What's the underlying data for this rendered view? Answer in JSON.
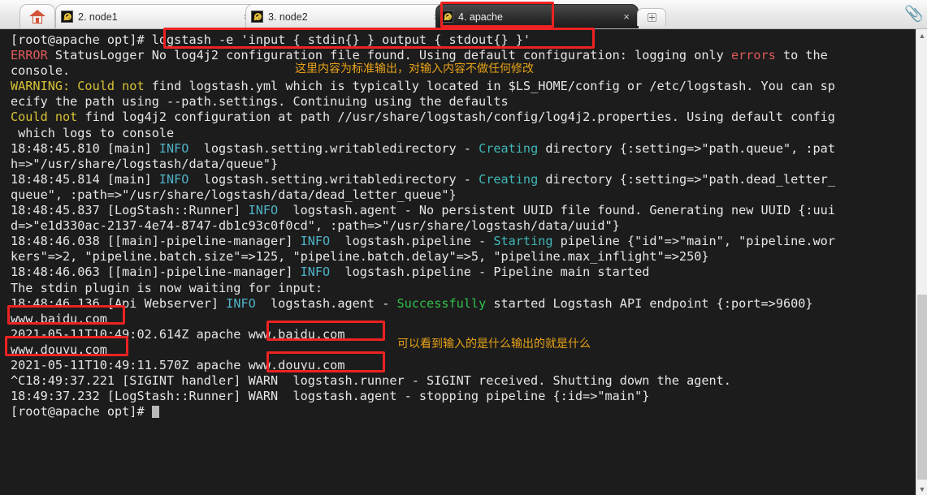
{
  "window": {
    "tabs": [
      {
        "label": "2. node1",
        "active": false,
        "icon": "wrench-icon"
      },
      {
        "label": "3. node2",
        "active": false,
        "icon": "wrench-icon"
      },
      {
        "label": "4. apache",
        "active": true,
        "icon": "wrench-icon"
      }
    ],
    "home_tab_icon": "home-icon",
    "new_tab_label": "+",
    "close_label": "×",
    "attachment_icon": "paperclip-icon"
  },
  "colors": {
    "terminal_bg": "#1c1c1c",
    "terminal_fg": "#e6e6e6",
    "error_red": "#e05a5a",
    "warn_yellow": "#d7c234",
    "info_cyan": "#4fb3c8",
    "ok_green": "#2fc14b",
    "annotation_orange": "#e8a317",
    "highlight_box": "#ee2222"
  },
  "terminal": {
    "prompt": "[root@apache opt]# ",
    "command": "logstash -e 'input { stdin{} } output { stdout{} }'",
    "final_prompt": "[root@apache opt]# ",
    "lines": [
      {
        "id": "l1",
        "segments": [
          {
            "t": "[root@apache opt]# ",
            "c": "c-white"
          },
          {
            "t": "logstash -e 'input { stdin{} } output { stdout{} }'",
            "c": "c-white"
          }
        ]
      },
      {
        "id": "l2",
        "segments": [
          {
            "t": "ERROR",
            "c": "c-red"
          },
          {
            "t": " StatusLogger No log4j2 configuration file found. Using default configuration: logging only ",
            "c": "c-white"
          },
          {
            "t": "errors",
            "c": "c-red"
          },
          {
            "t": " to the",
            "c": "c-white"
          }
        ]
      },
      {
        "id": "l3",
        "segments": [
          {
            "t": "console.",
            "c": "c-white"
          }
        ]
      },
      {
        "id": "l4",
        "segments": [
          {
            "t": "WARNING: Could not",
            "c": "c-yellow"
          },
          {
            "t": " find logstash.yml which is typically located in $LS_HOME/config or /etc/logstash. You can sp",
            "c": "c-white"
          }
        ]
      },
      {
        "id": "l5",
        "segments": [
          {
            "t": "ecify the path using --path.settings. Continuing using the defaults",
            "c": "c-white"
          }
        ]
      },
      {
        "id": "l6",
        "segments": [
          {
            "t": "Could not",
            "c": "c-yellow"
          },
          {
            "t": " find log4j2 configuration at path //usr/share/logstash/config/log4j2.properties. Using default config",
            "c": "c-white"
          }
        ]
      },
      {
        "id": "l7",
        "segments": [
          {
            "t": " which logs to console",
            "c": "c-white"
          }
        ]
      },
      {
        "id": "l8",
        "segments": [
          {
            "t": "18:48:45.810 [main] ",
            "c": "c-white"
          },
          {
            "t": "INFO",
            "c": "c-cyan"
          },
          {
            "t": "  logstash.setting.writabledirectory - ",
            "c": "c-white"
          },
          {
            "t": "Creating",
            "c": "c-teal"
          },
          {
            "t": " directory {:setting=>\"path.queue\", :pat",
            "c": "c-white"
          }
        ]
      },
      {
        "id": "l9",
        "segments": [
          {
            "t": "h=>\"/usr/share/logstash/data/queue\"}",
            "c": "c-white"
          }
        ]
      },
      {
        "id": "l10",
        "segments": [
          {
            "t": "18:48:45.814 [main] ",
            "c": "c-white"
          },
          {
            "t": "INFO",
            "c": "c-cyan"
          },
          {
            "t": "  logstash.setting.writabledirectory - ",
            "c": "c-white"
          },
          {
            "t": "Creating",
            "c": "c-teal"
          },
          {
            "t": " directory {:setting=>\"path.dead_letter_",
            "c": "c-white"
          }
        ]
      },
      {
        "id": "l11",
        "segments": [
          {
            "t": "queue\", :path=>\"/usr/share/logstash/data/dead_letter_queue\"}",
            "c": "c-white"
          }
        ]
      },
      {
        "id": "l12",
        "segments": [
          {
            "t": "18:48:45.837 [LogStash::Runner] ",
            "c": "c-white"
          },
          {
            "t": "INFO",
            "c": "c-cyan"
          },
          {
            "t": "  logstash.agent - No persistent UUID file found. Generating new UUID {:uui",
            "c": "c-white"
          }
        ]
      },
      {
        "id": "l13",
        "segments": [
          {
            "t": "d=>\"e1d330ac-2137-4e74-8747-db1c93c0f0cd\", :path=>\"/usr/share/logstash/data/uuid\"}",
            "c": "c-white"
          }
        ]
      },
      {
        "id": "l14",
        "segments": [
          {
            "t": "18:48:46.038 [[main]-pipeline-manager] ",
            "c": "c-white"
          },
          {
            "t": "INFO",
            "c": "c-cyan"
          },
          {
            "t": "  logstash.pipeline - ",
            "c": "c-white"
          },
          {
            "t": "Starting",
            "c": "c-teal"
          },
          {
            "t": " pipeline {\"id\"=>\"main\", \"pipeline.wor",
            "c": "c-white"
          }
        ]
      },
      {
        "id": "l15",
        "segments": [
          {
            "t": "kers\"=>2, \"pipeline.batch.size\"=>125, \"pipeline.batch.delay\"=>5, \"pipeline.max_inflight\"=>250}",
            "c": "c-white"
          }
        ]
      },
      {
        "id": "l16",
        "segments": [
          {
            "t": "18:48:46.063 [[main]-pipeline-manager] ",
            "c": "c-white"
          },
          {
            "t": "INFO",
            "c": "c-cyan"
          },
          {
            "t": "  logstash.pipeline - Pipeline main started",
            "c": "c-white"
          }
        ]
      },
      {
        "id": "l17",
        "segments": [
          {
            "t": "The stdin plugin is now waiting for input:",
            "c": "c-white"
          }
        ]
      },
      {
        "id": "l18",
        "segments": [
          {
            "t": "18:48:46.136 [Api Webserver] ",
            "c": "c-white"
          },
          {
            "t": "INFO",
            "c": "c-cyan"
          },
          {
            "t": "  logstash.agent - ",
            "c": "c-white"
          },
          {
            "t": "Successfully",
            "c": "c-green"
          },
          {
            "t": " started Logstash API endpoint {:port=>9600}",
            "c": "c-white"
          }
        ]
      },
      {
        "id": "l19",
        "segments": [
          {
            "t": "www.baidu.com",
            "c": "c-white"
          }
        ]
      },
      {
        "id": "l20",
        "segments": [
          {
            "t": "2021-05-11T10:49:02.614Z apache www.baidu.com",
            "c": "c-white"
          }
        ]
      },
      {
        "id": "l21",
        "segments": [
          {
            "t": "www.douyu.com",
            "c": "c-white"
          }
        ]
      },
      {
        "id": "l22",
        "segments": [
          {
            "t": "2021-05-11T10:49:11.570Z apache www.douyu.com",
            "c": "c-white"
          }
        ]
      },
      {
        "id": "l23",
        "segments": [
          {
            "t": "^C18:49:37.221 [SIGINT handler] WARN  logstash.runner - SIGINT received. Shutting down the agent.",
            "c": "c-white"
          }
        ]
      },
      {
        "id": "l24",
        "segments": [
          {
            "t": "18:49:37.232 [LogStash::Runner] WARN  logstash.agent - stopping pipeline {:id=>\"main\"}",
            "c": "c-white"
          }
        ]
      },
      {
        "id": "l25",
        "segments": [
          {
            "t": "[root@apache opt]# ",
            "c": "c-white"
          },
          {
            "t": "█",
            "c": "c-cursor"
          }
        ]
      }
    ]
  },
  "annotations": [
    {
      "id": "a1",
      "text": "这里内容为标准输出，对输入内容不做任何修改"
    },
    {
      "id": "a2",
      "text": "可以看到输入的是什么输出的就是什么"
    }
  ],
  "highlight_boxes": [
    {
      "id": "hb-command",
      "target": "logstash-command"
    },
    {
      "id": "hb-tab-apache",
      "target": "tab-4-apache"
    },
    {
      "id": "hb-input-baidu",
      "target": "stdin-baidu"
    },
    {
      "id": "hb-out-baidu",
      "target": "stdout-baidu"
    },
    {
      "id": "hb-input-douyu",
      "target": "stdin-douyu"
    },
    {
      "id": "hb-out-douyu",
      "target": "stdout-douyu"
    }
  ],
  "scrollbar": {
    "up_arrow": "▲",
    "down_arrow": "▼"
  }
}
